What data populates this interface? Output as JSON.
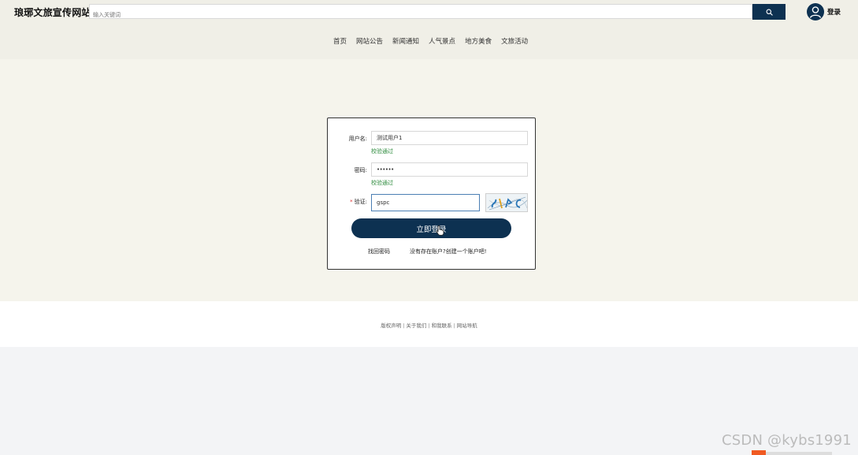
{
  "site": {
    "title": "琅琊文旅宣传网站"
  },
  "search": {
    "placeholder": "输入关键词"
  },
  "header": {
    "login_label": "登录"
  },
  "nav": {
    "items": [
      {
        "label": "首页"
      },
      {
        "label": "网站公告"
      },
      {
        "label": "新闻通知"
      },
      {
        "label": "人气景点"
      },
      {
        "label": "地方美食"
      },
      {
        "label": "文旅活动"
      }
    ]
  },
  "login_form": {
    "username": {
      "label": "用户名:",
      "value": "测试用户1",
      "validation": "校验通过"
    },
    "password": {
      "label": "密码:",
      "value": "••••••",
      "validation": "校验通过"
    },
    "captcha": {
      "required_mark": "*",
      "label": "验证:",
      "value": "gspc"
    },
    "submit_label": "立即登录",
    "forgot_password_label": "找回密码",
    "register_label": "没有存在账户?创建一个账户吧!"
  },
  "footer": {
    "links": [
      {
        "label": "版权声明"
      },
      {
        "label": "关于我们"
      },
      {
        "label": "和我联系"
      },
      {
        "label": "网站导航"
      }
    ],
    "separator": "|"
  },
  "watermark": "CSDN @kybs1991",
  "colors": {
    "primary": "#0d3151",
    "header_bg": "#f0efe7",
    "main_bg": "#f5f4ec",
    "valid_text": "#2e8b3e"
  }
}
